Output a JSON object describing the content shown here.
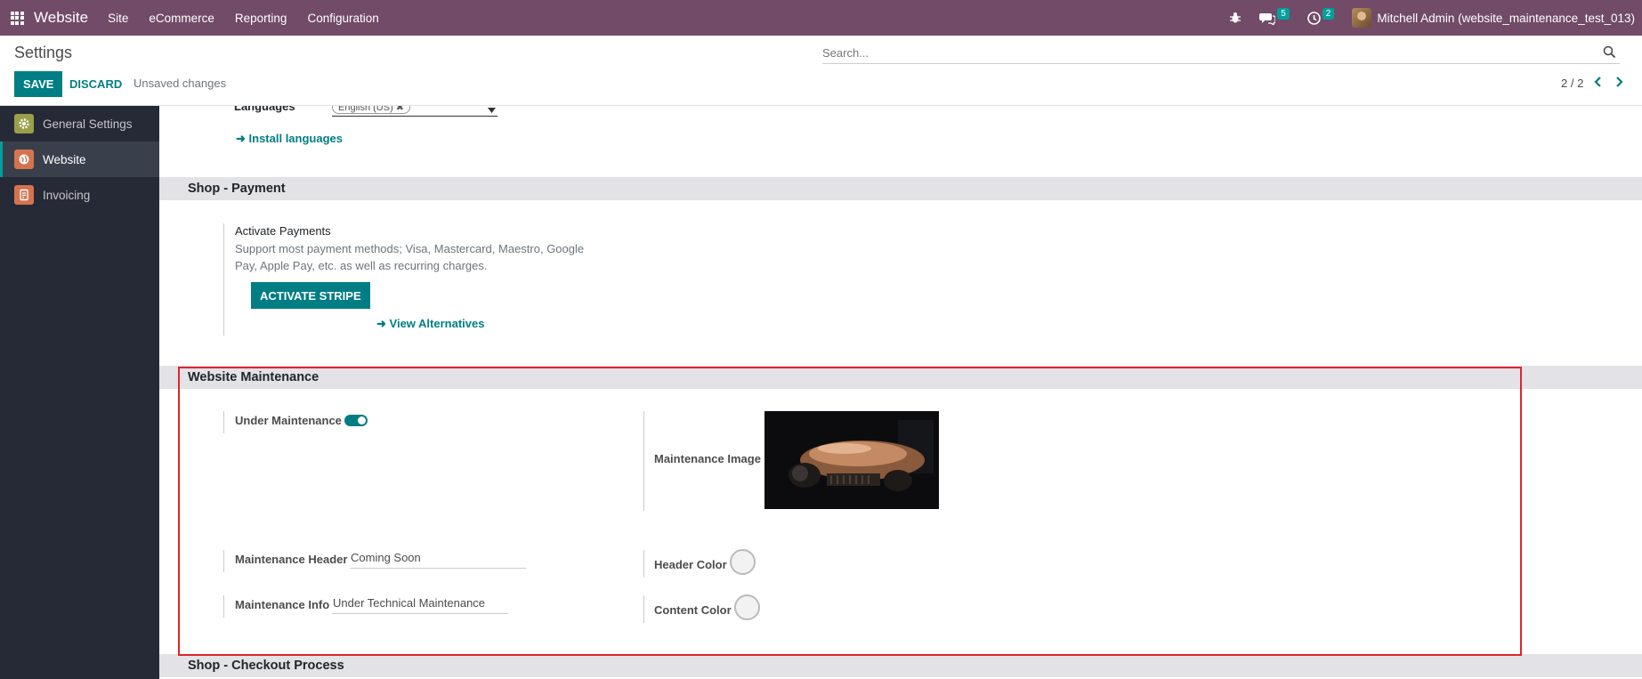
{
  "navbar": {
    "brand": "Website",
    "menu": [
      "Site",
      "eCommerce",
      "Reporting",
      "Configuration"
    ],
    "messages_count": "5",
    "activities_count": "2",
    "user": "Mitchell Admin (website_maintenance_test_013)"
  },
  "control": {
    "title": "Settings",
    "search_placeholder": "Search...",
    "save_label": "SAVE",
    "discard_label": "DISCARD",
    "unsaved_label": "Unsaved changes",
    "pager": "2 / 2"
  },
  "sidebar": {
    "items": [
      {
        "label": "General Settings",
        "color": "#9aa04a"
      },
      {
        "label": "Website",
        "color": "#d5734f"
      },
      {
        "label": "Invoicing",
        "color": "#d5734f"
      }
    ]
  },
  "languages": {
    "label": "Languages",
    "tag": "English (US)",
    "install_link": "Install languages"
  },
  "payment": {
    "section_title": "Shop - Payment",
    "setting_title": "Activate Payments",
    "description_line1": "Support most payment methods; Visa, Mastercard, Maestro, Google",
    "description_line2": "Pay, Apple Pay, etc. as well as recurring charges.",
    "activate_button": "ACTIVATE STRIPE",
    "alternatives_link": "View Alternatives"
  },
  "maintenance": {
    "section_title": "Website Maintenance",
    "under_maintenance_label": "Under Maintenance",
    "under_maintenance_enabled": true,
    "image_label": "Maintenance Image",
    "header_label": "Maintenance Header",
    "header_value": "Coming Soon",
    "info_label": "Maintenance Info",
    "info_value": "Under Technical Maintenance",
    "header_color_label": "Header Color",
    "content_color_label": "Content Color",
    "accent_color": "#017e84",
    "highlight_color": "#e0242b"
  },
  "checkout": {
    "section_title": "Shop - Checkout Process"
  }
}
